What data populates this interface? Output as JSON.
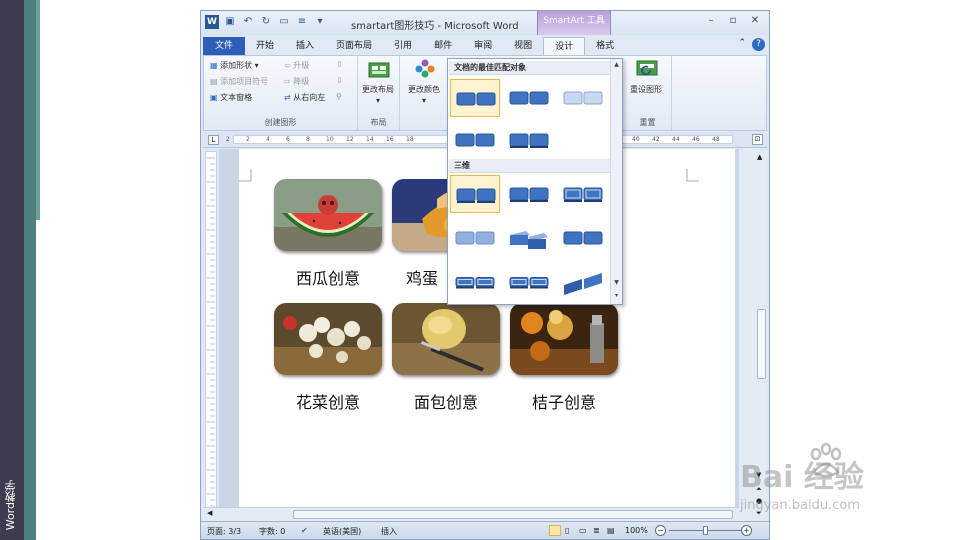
{
  "side": {
    "label": "Word教学"
  },
  "window": {
    "title": "smartart图形技巧 - Microsoft Word",
    "context_tab": "SmartArt 工具",
    "app_icon": "W"
  },
  "tabs": [
    "文件",
    "开始",
    "插入",
    "页面布局",
    "引用",
    "邮件",
    "审阅",
    "视图",
    "设计",
    "格式"
  ],
  "ribbon": {
    "create_group": {
      "label": "创建图形",
      "add_shape": "添加形状",
      "add_bullet": "添加项目符号",
      "text_pane": "文本窗格",
      "promote": "升级",
      "demote": "降级",
      "right_to_left": "从右向左"
    },
    "layout_group": {
      "label": "布局",
      "change_layout": "更改布局"
    },
    "styles_group": {
      "change_colors": "更改颜色"
    },
    "reset_group": {
      "label": "重置",
      "reset_graphic": "重设图形"
    }
  },
  "ruler_numbers": [
    "2",
    "2",
    "4",
    "6",
    "8",
    "10",
    "12",
    "14",
    "16",
    "18",
    "38",
    "40",
    "42",
    "44",
    "46",
    "48"
  ],
  "smartart": {
    "items": [
      {
        "caption": "西瓜创意"
      },
      {
        "caption": "鸡蛋"
      },
      {
        "caption": "花菜创意"
      },
      {
        "caption": "面包创意"
      },
      {
        "caption": "桔子创意"
      }
    ]
  },
  "gallery": {
    "section1": "文档的最佳匹配对象",
    "section2": "三维"
  },
  "status": {
    "page": "页面: 3/3",
    "words": "字数: 0",
    "language": "英语(美国)",
    "mode": "插入",
    "zoom": "100%"
  },
  "watermark": {
    "brand": "Bai  经验",
    "url": "jingyan.baidu.com"
  },
  "colors": {
    "file_tab": "#2b5fb8",
    "context_tab": "#b79fd8",
    "accent": "#2b5797"
  }
}
